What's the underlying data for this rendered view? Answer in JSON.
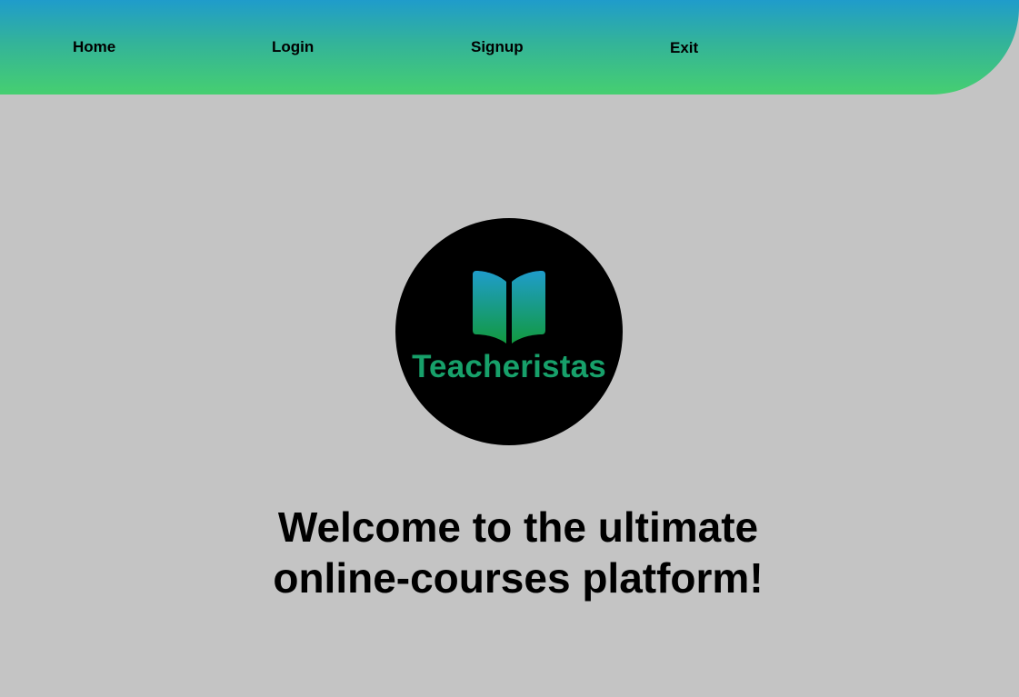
{
  "nav": {
    "items": [
      {
        "label": "Home"
      },
      {
        "label": "Login"
      },
      {
        "label": "Signup"
      },
      {
        "label": "Exit"
      }
    ]
  },
  "logo": {
    "brand_name": "Teacheristas",
    "icon": "open-book-icon"
  },
  "hero": {
    "headline_line1": "Welcome to the ultimate",
    "headline_line2": "online-courses platform!"
  },
  "colors": {
    "page_background": "#c4c4c4",
    "nav_gradient_top": "#1f9ccb",
    "nav_gradient_bottom": "#46cf70",
    "logo_background": "#000000",
    "brand_text": "#17a06a"
  }
}
